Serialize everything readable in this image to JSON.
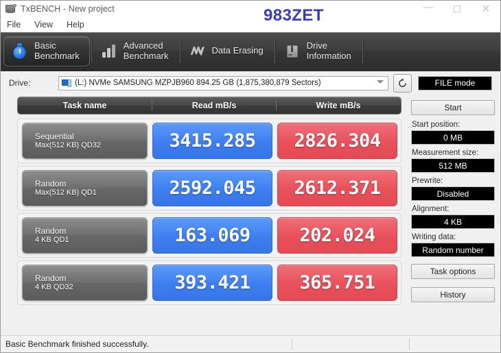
{
  "window": {
    "title": "TxBENCH - New project",
    "brand": "983ZET",
    "icon": "application-icon",
    "controls": {
      "minimize": "—",
      "maximize": "□",
      "close": "✕"
    }
  },
  "menu": {
    "items": [
      "File",
      "View",
      "Help"
    ]
  },
  "tabs": [
    {
      "label_line1": "Basic",
      "label_line2": "Benchmark",
      "icon": "stopwatch-icon",
      "active": true
    },
    {
      "label_line1": "Advanced",
      "label_line2": "Benchmark",
      "icon": "bar-chart-icon",
      "active": false
    },
    {
      "label_line1": "Data Erasing",
      "label_line2": "",
      "icon": "erase-icon",
      "active": false
    },
    {
      "label_line1": "Drive",
      "label_line2": "Information",
      "icon": "drive-info-icon",
      "active": false
    }
  ],
  "drive": {
    "label": "Drive:",
    "selected": "(L:) NVMe SAMSUNG MZPJB960  894.25 GB (1,875,380,879 Sectors)",
    "icon": "drive-icon",
    "refresh_icon": "refresh-icon",
    "mode_button": "FILE mode"
  },
  "table": {
    "headers": [
      "Task name",
      "Read mB/s",
      "Write mB/s"
    ],
    "rows": [
      {
        "task_line1": "Sequential",
        "task_line2": "Max(512 KB) QD32",
        "read": "3415.285",
        "write": "2826.304"
      },
      {
        "task_line1": "Random",
        "task_line2": "Max(512 KB) QD1",
        "read": "2592.045",
        "write": "2612.371"
      },
      {
        "task_line1": "Random",
        "task_line2": "4 KB QD1",
        "read": "163.069",
        "write": "202.024"
      },
      {
        "task_line1": "Random",
        "task_line2": "4 KB QD32",
        "read": "393.421",
        "write": "365.751"
      }
    ]
  },
  "sidebar": {
    "start_button": "Start",
    "fields": [
      {
        "label": "Start position:",
        "value": "0 MB"
      },
      {
        "label": "Measurement size:",
        "value": "512 MB"
      },
      {
        "label": "Prewrite:",
        "value": "Disabled"
      },
      {
        "label": "Alignment:",
        "value": "4 KB"
      },
      {
        "label": "Writing data:",
        "value": "Random number"
      }
    ],
    "task_options_button": "Task options",
    "history_button": "History"
  },
  "status": {
    "message": "Basic Benchmark finished successfully."
  },
  "colors": {
    "read_pill": "#3d7ef0",
    "write_pill": "#e8505a",
    "brand": "#3b3bbe",
    "tab_strip": "#3d3d3d",
    "task_cell": "#6f6f6f"
  }
}
